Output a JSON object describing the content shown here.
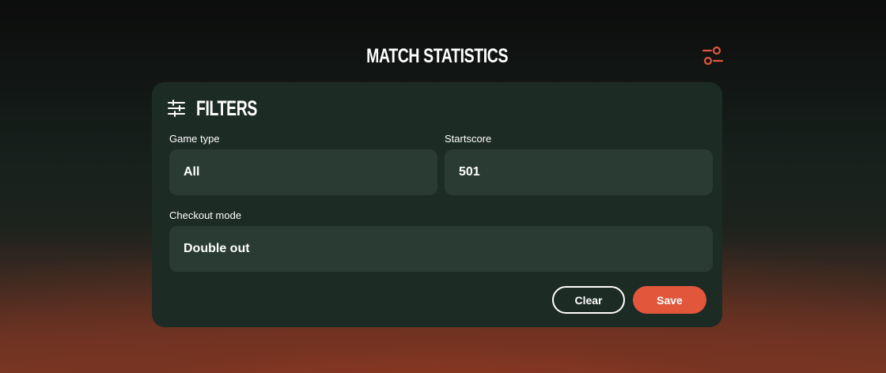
{
  "header": {
    "title": "MATCH STATISTICS",
    "settings_icon": "filter-settings-icon"
  },
  "filters": {
    "icon": "sliders-icon",
    "title": "FILTERS",
    "game_type": {
      "label": "Game type",
      "value": "All"
    },
    "startscore": {
      "label": "Startscore",
      "value": "501"
    },
    "checkout_mode": {
      "label": "Checkout mode",
      "value": "Double out"
    },
    "clear_label": "Clear",
    "save_label": "Save"
  },
  "colors": {
    "accent": "#e2563c",
    "panel": "#1d2b25",
    "field": "#2a3b33"
  }
}
